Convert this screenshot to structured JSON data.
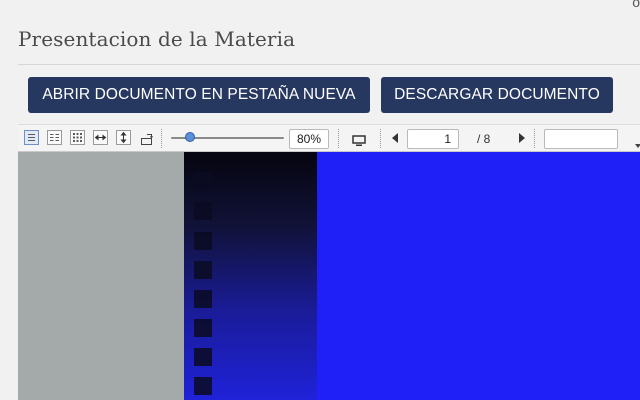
{
  "header": {
    "title": "Presentacion de la Materia",
    "corner_glyph": "o"
  },
  "actions": {
    "open_new_tab_label": "ABRIR DOCUMENTO EN PESTAÑA NUEVA",
    "download_label": "DESCARGAR DOCUMENTO"
  },
  "viewer": {
    "toolbar": {
      "view_mode_icons": [
        "single-page-icon",
        "two-page-icon",
        "thumbnail-grid-icon",
        "fit-width-icon",
        "fit-height-icon",
        "rotate-icon"
      ],
      "zoom_value": "80%",
      "zoom_level_fraction": 0.17,
      "presentation_icon": "monitor-icon",
      "current_page": "1",
      "total_pages": "/ 8",
      "search_value": ""
    },
    "document_colors": {
      "page_background": "#1f1ff7",
      "viewer_background": "#a3aaa9"
    }
  },
  "theme": {
    "button_color": "#273860",
    "button_text_color": "#ffffff",
    "page_background": "#f1f1f1"
  }
}
